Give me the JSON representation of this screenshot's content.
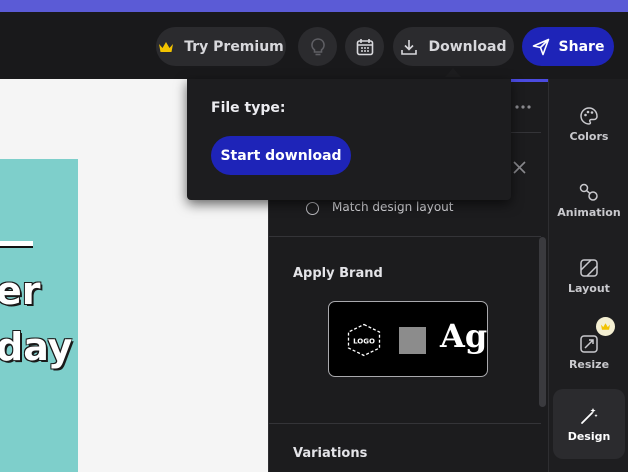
{
  "toolbar": {
    "premium_label": "Try Premium",
    "download_label": "Download",
    "share_label": "Share"
  },
  "canvas": {
    "lines": [
      "er",
      "day"
    ]
  },
  "panel": {
    "radio_label": "Match design layout",
    "apply_brand_title": "Apply Brand",
    "logo_text": "LOGO",
    "font_sample": "Ag",
    "variations_title": "Variations"
  },
  "dropdown": {
    "file_type_label": "File type:",
    "start_download_label": "Start download"
  },
  "rail": {
    "items": [
      {
        "label": "Colors",
        "icon": "palette-icon"
      },
      {
        "label": "Animation",
        "icon": "animation-icon"
      },
      {
        "label": "Layout",
        "icon": "layout-icon"
      },
      {
        "label": "Resize",
        "icon": "resize-icon"
      },
      {
        "label": "Design",
        "icon": "design-icon"
      }
    ]
  },
  "colors": {
    "accent": "#1e24b8",
    "top_strip": "#5b5bd6",
    "tile": "#7ecfcb",
    "crown": "#f2c300"
  }
}
